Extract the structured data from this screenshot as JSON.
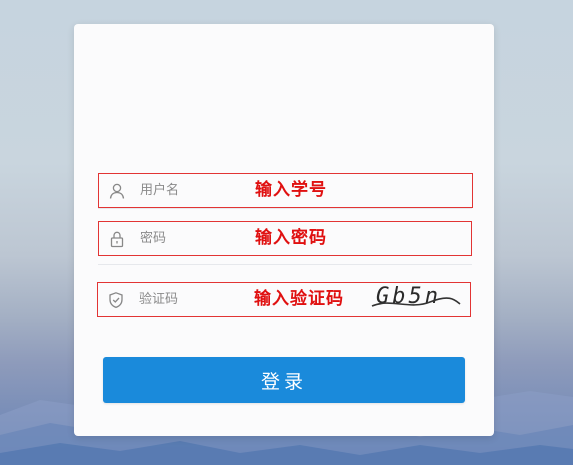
{
  "form": {
    "username": {
      "placeholder": "用户名",
      "annotation": "输入学号",
      "icon": "user-icon"
    },
    "password": {
      "placeholder": "密码",
      "annotation": "输入密码",
      "icon": "lock-icon"
    },
    "captcha": {
      "placeholder": "验证码",
      "annotation": "输入验证码",
      "icon": "shield-icon",
      "captcha_text": "Gb5n"
    },
    "login_label": "登录"
  },
  "colors": {
    "accent": "#1a8adb",
    "annotation": "#e01010",
    "field_border": "#e23434"
  }
}
